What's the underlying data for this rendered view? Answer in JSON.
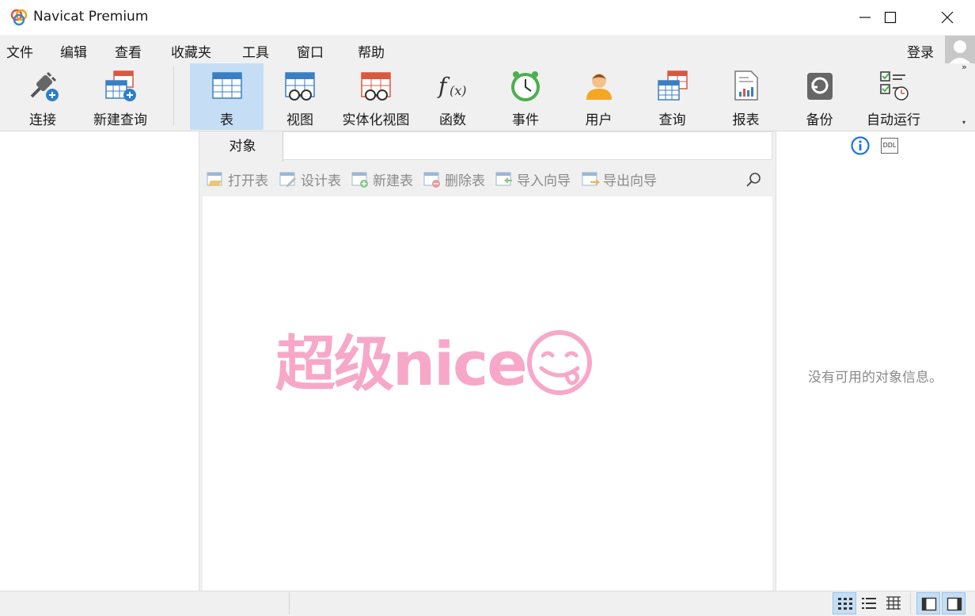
{
  "app": {
    "title": "Navicat Premium"
  },
  "menu": {
    "items": [
      "文件",
      "编辑",
      "查看",
      "收藏夹",
      "工具",
      "窗口",
      "帮助"
    ],
    "login": "登录"
  },
  "toolbar": {
    "connect": "连接",
    "new_query": "新建查询",
    "table": "表",
    "view": "视图",
    "mat_view": "实体化视图",
    "function": "函数",
    "event": "事件",
    "user": "用户",
    "query": "查询",
    "report": "报表",
    "backup": "备份",
    "auto_run": "自动运行"
  },
  "objects_tab": {
    "label": "对象"
  },
  "object_tools": {
    "open": "打开表",
    "design": "设计表",
    "new": "新建表",
    "delete": "删除表",
    "import": "导入向导",
    "export": "导出向导"
  },
  "watermark": {
    "text": "超级nice"
  },
  "info_pane": {
    "empty": "没有可用的对象信息。",
    "ddl": "DDL"
  },
  "colors": {
    "accent": "#c5def5",
    "watermark": "#f7a8c8",
    "blue": "#3a7fc4",
    "red": "#d9583f"
  }
}
